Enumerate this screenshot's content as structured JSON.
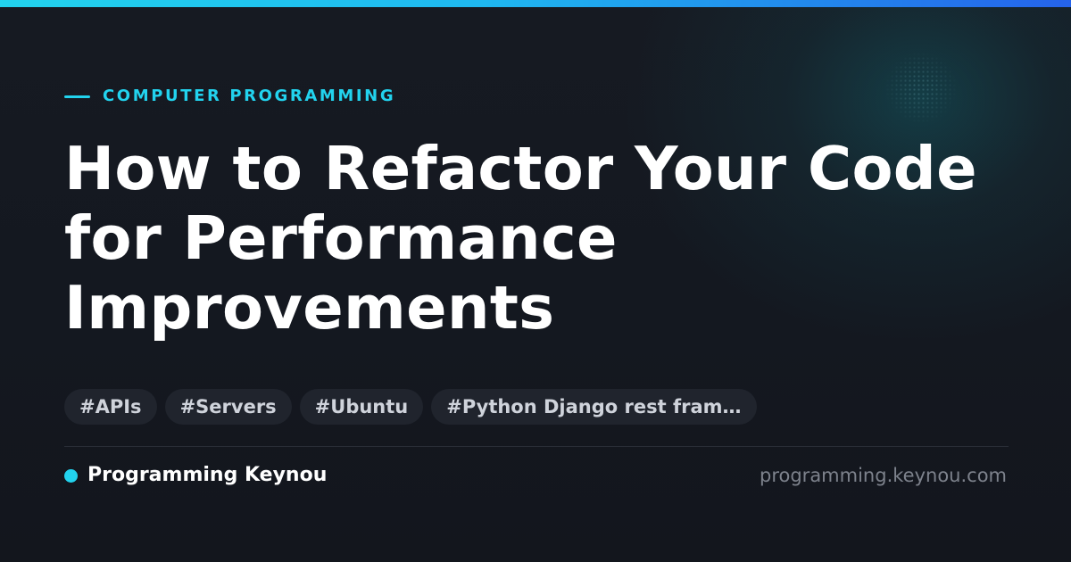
{
  "colors": {
    "accent": "#22d3ee",
    "accent_gradient_end": "#2563eb",
    "background": "#14171f",
    "tag_background": "#20242d",
    "title": "#ffffff",
    "muted": "#7d828c"
  },
  "category": "COMPUTER PROGRAMMING",
  "title_lines": [
    "How to Refactor Your Code",
    "for Performance",
    "Improvements"
  ],
  "tags": [
    "#APIs",
    "#Servers",
    "#Ubuntu",
    "#Python Django rest fram…"
  ],
  "footer": {
    "brand_name": "Programming Keynou",
    "domain": "programming.keynou.com"
  }
}
